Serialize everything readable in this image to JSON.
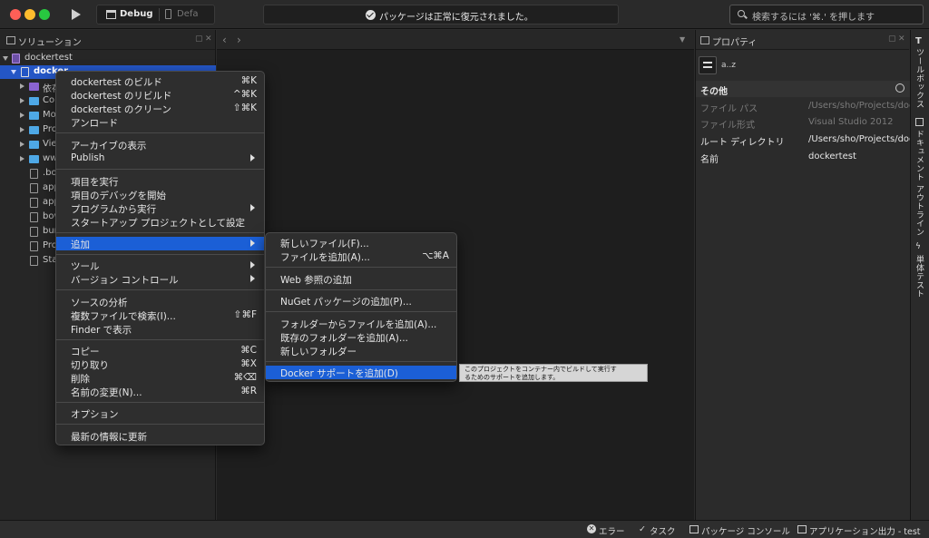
{
  "toolbar": {
    "config_label": "Debug",
    "device_label": "Defa",
    "status_text": "パッケージは正常に復元されました。",
    "search_placeholder": "検索するには '⌘.' を押します"
  },
  "colors": {
    "selection": "#2456c6",
    "menu_highlight": "#1b5fd6",
    "close": "#fe5f57",
    "minimize": "#febc2e",
    "maximize": "#28c840"
  },
  "solution": {
    "title": "ソリューション",
    "root": "dockertest",
    "project": "docker",
    "items": [
      "依存",
      "Con",
      "Mod",
      "Pro",
      "View",
      "www",
      ".bo",
      "app",
      "app",
      "bow",
      "bun",
      "Prog",
      "Star"
    ]
  },
  "context_menu": {
    "build": "dockertest のビルド",
    "build_sc": "⌘K",
    "rebuild": "dockertest のリビルド",
    "rebuild_sc": "^⌘K",
    "clean": "dockertest のクリーン",
    "clean_sc": "⇧⌘K",
    "unload": "アンロード",
    "archive": "アーカイブの表示",
    "publish": "Publish",
    "run": "項目を実行",
    "debug": "項目のデバッグを開始",
    "run_with": "プログラムから実行",
    "startup": "スタートアップ プロジェクトとして設定",
    "add": "追加",
    "tools": "ツール",
    "vcs": "バージョン コントロール",
    "analyze": "ソースの分析",
    "find": "複数ファイルで検索(I)...",
    "find_sc": "⇧⌘F",
    "finder": "Finder で表示",
    "copy": "コピー",
    "copy_sc": "⌘C",
    "cut": "切り取り",
    "cut_sc": "⌘X",
    "delete": "削除",
    "delete_sc": "⌘⌫",
    "rename": "名前の変更(N)...",
    "rename_sc": "⌘R",
    "options": "オプション",
    "refresh": "最新の情報に更新"
  },
  "submenu": {
    "new_file": "新しいファイル(F)...",
    "add_files": "ファイルを追加(A)...",
    "add_files_sc": "⌥⌘A",
    "web_ref": "Web 参照の追加",
    "nuget": "NuGet パッケージの追加(P)...",
    "add_from_folder": "フォルダーからファイルを追加(A)...",
    "existing_folder": "既存のフォルダーを追加(A)...",
    "new_folder": "新しいフォルダー",
    "docker": "Docker サポートを追加(D)"
  },
  "tooltip": {
    "line1": "このプロジェクトをコンテナー内でビルドして実行す",
    "line2": "るためのサポートを追加します。"
  },
  "properties": {
    "title": "プロパティ",
    "sort_label": "a..z",
    "category": "その他",
    "rows": [
      {
        "key": "ファイル パス",
        "value": "/Users/sho/Projects/docker"
      },
      {
        "key": "ファイル形式",
        "value": "Visual Studio 2012"
      },
      {
        "key": "ルート ディレクトリ",
        "value": "/Users/sho/Projects/docker"
      },
      {
        "key": "名前",
        "value": "dockertest"
      }
    ]
  },
  "side_tabs": {
    "toolbox": "ツールボックス",
    "doc_outline": "ドキュメント アウトライン",
    "unit_tests": "単体テスト"
  },
  "bottom_bar": {
    "errors": "エラー",
    "tasks": "タスク",
    "package_console": "パッケージ コンソール",
    "app_output": "アプリケーション出力 - test"
  }
}
